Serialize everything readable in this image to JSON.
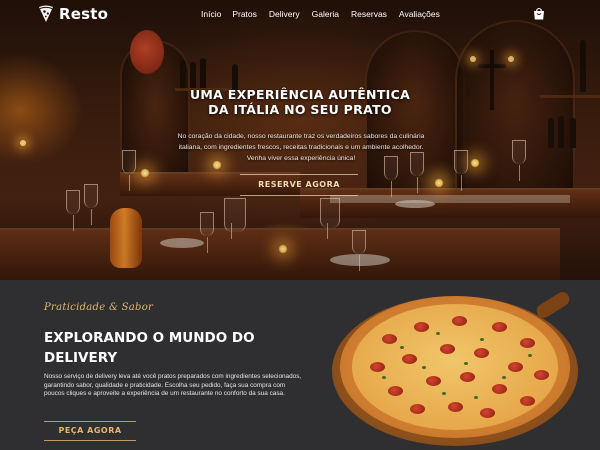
{
  "brand": {
    "name": "Resto"
  },
  "nav": {
    "links": [
      "Início",
      "Pratos",
      "Delivery",
      "Galeria",
      "Reservas",
      "Avaliações"
    ],
    "cart_icon": "shopping-bag-icon"
  },
  "hero": {
    "title_line1": "Uma experiência autêntica",
    "title_line2": "da Itália no seu prato",
    "subtitle": "No coração da cidade, nosso restaurante traz os verdadeiros sabores da culinária italiana, com ingredientes frescos, receitas tradicionais e um ambiente acolhedor. Venha viver essa experiência única!",
    "cta": "Reserve agora"
  },
  "delivery": {
    "tagline": "Praticidade & Sabor",
    "title": "Explorando o mundo do delivery",
    "text": "Nosso serviço de delivery leva até você pratos preparados com ingredientes selecionados, garantindo sabor, qualidade e praticidade. Escolha seu pedido, faça sua compra com poucos cliques e aproveite a experiência de um restaurante no conforto da sua casa.",
    "cta": "Peça agora"
  },
  "colors": {
    "accent_gold": "#e2b86a",
    "section_bg": "#2f2f32"
  }
}
